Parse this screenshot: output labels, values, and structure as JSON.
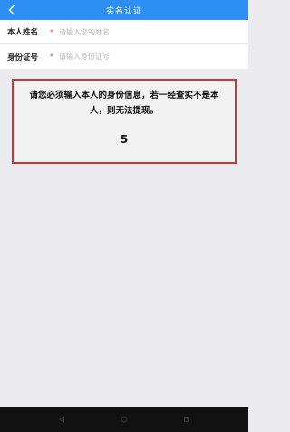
{
  "header": {
    "title": "实名认证"
  },
  "form": {
    "fields": [
      {
        "label": "本人姓名",
        "required_mark": "*",
        "placeholder": "请输入您的姓名"
      },
      {
        "label": "身份证号",
        "required_mark": "*",
        "placeholder": "请输入身份证号"
      }
    ]
  },
  "dialog": {
    "message": "请您必须输入本人的身份信息，若一经查实不是本人，则无法提现。",
    "countdown": "5"
  },
  "colors": {
    "header_bg": "#2d8ff3",
    "dialog_border": "#c0393b",
    "required": "#e33333"
  },
  "icons": {
    "back": "chevron-left-icon",
    "nav_back": "triangle-back-icon",
    "nav_home": "circle-home-icon",
    "nav_recent": "square-recent-icon"
  }
}
